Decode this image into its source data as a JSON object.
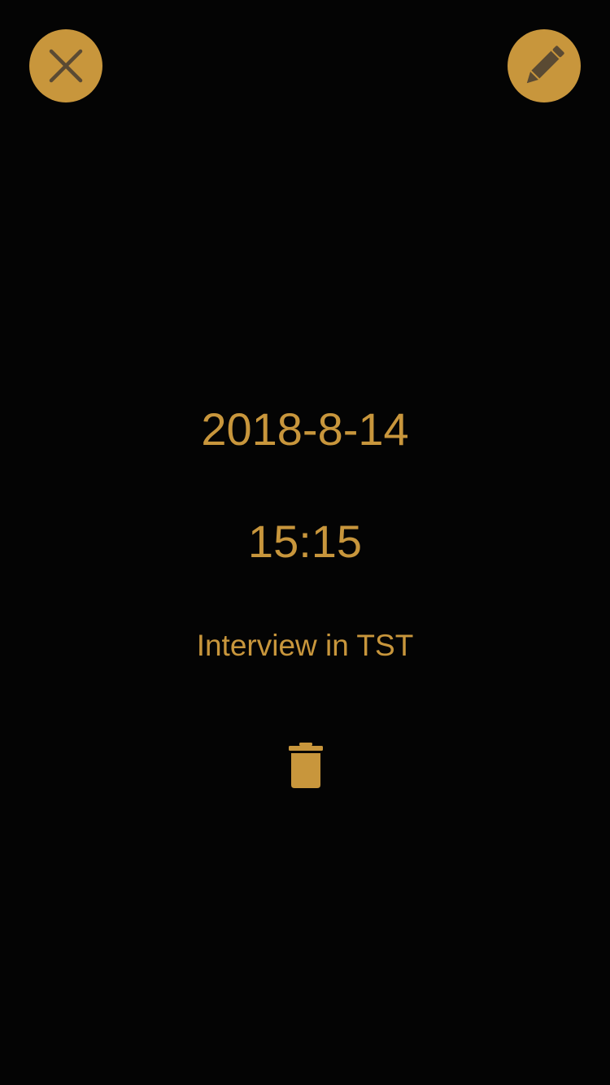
{
  "header": {
    "close_icon": "close-icon",
    "edit_icon": "pencil-icon"
  },
  "event": {
    "date": "2018-8-14",
    "time": "15:15",
    "title": "Interview in TST"
  },
  "actions": {
    "delete_icon": "trash-icon"
  },
  "colors": {
    "background": "#040404",
    "accent": "#c8963c",
    "icon_dark": "#5a4a33"
  }
}
